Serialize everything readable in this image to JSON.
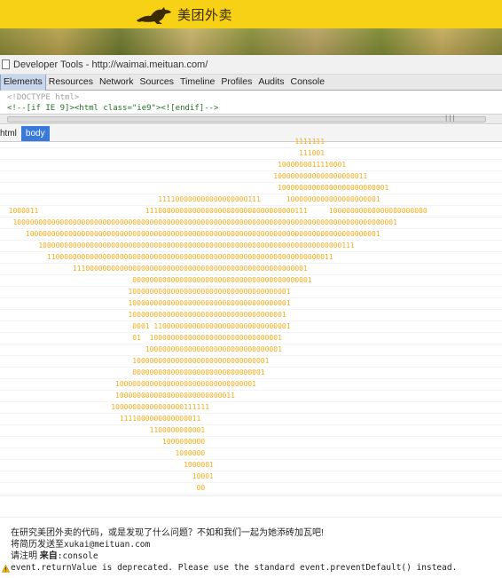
{
  "site": {
    "brand_name": "美团外卖",
    "logo_icon": "kangaroo-icon",
    "brand_color": "#f7d116"
  },
  "devtools": {
    "window_title": "Developer Tools - http://waimai.meituan.com/",
    "tabs": [
      "Elements",
      "Resources",
      "Network",
      "Sources",
      "Timeline",
      "Profiles",
      "Audits",
      "Console"
    ],
    "active_tab": "Elements",
    "source": {
      "doctype": "<!DOCTYPE html>",
      "conditional_comment": "<!--[if IE 9]><html class=\"ie9\"><![endif]-->"
    },
    "breadcrumb": [
      "html",
      "body"
    ],
    "active_crumb": "body"
  },
  "console": {
    "ascii_art_color": "#f2ac1c",
    "ascii_art": [
      "                                                                     1111111",
      "                                                                      111001",
      "                                                                 1000000011110001",
      "                                                                1000000000000000000011",
      "                                                                 10000000000000000000000001",
      "                                     111100000000000000000111      1000000000000000000001",
      "  1000011                         11100000000000000000000000000000000111     10000000000000000000000",
      "   100000000000000000000000000000000000000000000000000000000000000000000000000000000000000001",
      "      10000000000000000000000000000000000000000000000000000000000000000000000000000000001",
      "         10000000000000000000000000000000000000000000000000000000000000000000000111",
      "           1100000000000000000000000000000000000000000000000000000000000000011",
      "                 1110000000000000000000000000000000000000000000000000001",
      "                               000000000000000000000000000000000000000001",
      "                              10000000000000000000000000000000000001",
      "                              10000000000000000000000000000000000001",
      "                              1000000000000000000000000000000000001",
      "                               0001 11000000000000000000000000000001",
      "                               01  1000000000000000000000000000001",
      "                                  10000000000000000000000000000001",
      "                               10000000000000000000000000000001",
      "                               0000000000000000000000000000001",
      "                           100000000000000000000000000000001",
      "                           1000000000000000000000000011",
      "                          10000000000000000111111",
      "                            1111000000000000011",
      "                                   1100000000001",
      "                                      1000000000",
      "                                         1000000",
      "                                           1000001",
      "                                             10001",
      "                                              00"
    ],
    "message_1": "在研究美团外卖的代码，或是发现了什么问题？不如和我们一起为她添砖加瓦吧!",
    "message_2_prefix": "将简历发送至",
    "message_2_email": "xukai@meituan.com",
    "message_3_prefix": "请注明",
    "message_3_bold": "来自",
    "message_3_suffix": ":console",
    "warning": "event.returnValue is deprecated. Please use the standard event.preventDefault() instead.",
    "warning_icon": "warning-triangle-icon"
  }
}
